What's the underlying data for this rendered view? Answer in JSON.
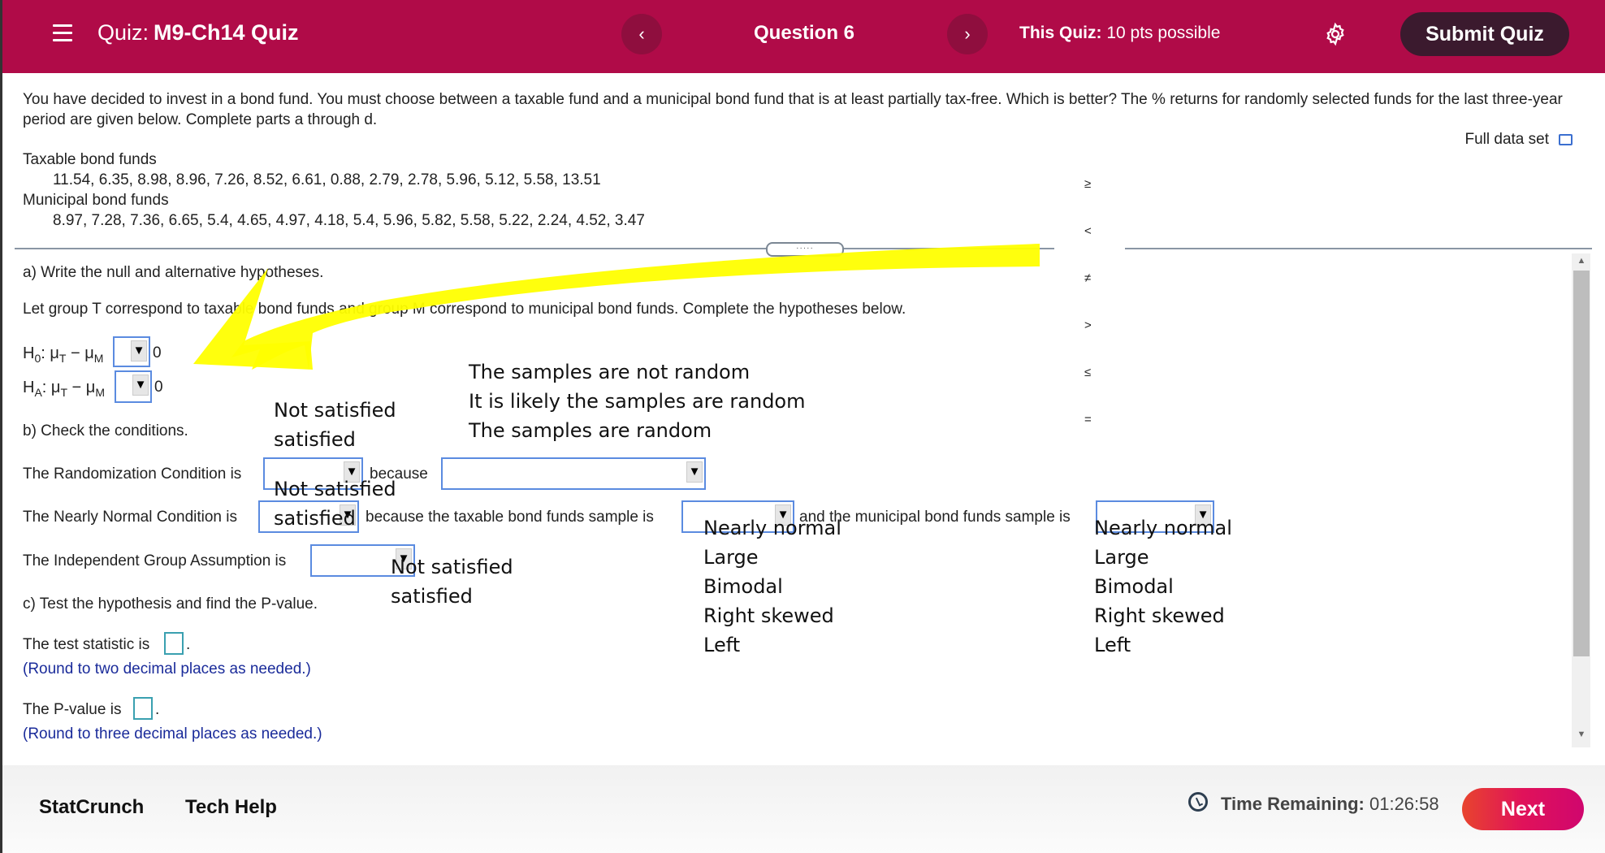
{
  "header": {
    "quiz_prefix": "Quiz:",
    "quiz_name": "M9-Ch14 Quiz",
    "prev_label": "‹",
    "next_label": "›",
    "question_label": "Question 6",
    "points_label": "This Quiz:",
    "points_value": "10 pts possible",
    "submit_label": "Submit Quiz",
    "bg_color": "#b00b48"
  },
  "question": {
    "intro": "You have decided to invest in a bond fund. You must choose between a taxable fund and a municipal bond fund that is at least partially tax-free. Which is better? The % returns for randomly selected funds for the last three-year period are given below. Complete parts a through d.",
    "full_data_label": "Full data set",
    "taxable_label": "Taxable bond funds",
    "taxable_values": "11.54, 6.35, 8.98, 8.96, 7.26, 8.52, 6.61, 0.88, 2.79, 2.78, 5.96, 5.12, 5.58, 13.51",
    "municipal_label": "Municipal bond funds",
    "municipal_values": "8.97, 7.28, 7.36, 6.65, 5.4, 4.65, 4.97, 4.18, 5.4, 5.96, 5.82, 5.58, 5.22, 2.24, 4.52, 3.47",
    "splitter_label": "·····"
  },
  "part_a": {
    "heading": "a) Write the null and alternative hypotheses.",
    "instruction": "Let group T correspond to taxable bond funds and group M correspond to municipal bond funds. Complete the hypotheses below.",
    "h0_label": "H",
    "h0_sub": "0",
    "ha_label": "H",
    "ha_sub": "A",
    "mu_t": ": μ",
    "sub_t": "T",
    "minus_mu": " − μ",
    "sub_m": "M",
    "h0_value": "",
    "ha_value": "",
    "rhs": "0",
    "operator_options": [
      "≥",
      "<",
      "≠",
      ">",
      "≤",
      "="
    ]
  },
  "part_b": {
    "heading": "b) Check the conditions.",
    "randomization_label": "The Randomization Condition is",
    "randomization_value": "",
    "because": "because",
    "because_value": "",
    "nearly_normal_label": "The Nearly Normal Condition is",
    "nearly_normal_value": "",
    "taxable_sample_label": "because the taxable bond funds sample is",
    "taxable_sample_value": "",
    "municipal_sample_label": "and the municipal bond funds sample is",
    "municipal_sample_value": "",
    "independent_label": "The Independent Group Assumption is",
    "independent_value": "",
    "condition_options": [
      "Not satisfied",
      "satisfied"
    ],
    "reason_options": [
      "The samples are not random",
      "It is likely the samples are random",
      "The samples are random"
    ],
    "shape_options": [
      "Nearly normal",
      "Large",
      "Bimodal",
      "Right skewed",
      "Left"
    ]
  },
  "part_c": {
    "heading": "c) Test the hypothesis and find the P-value.",
    "test_stat_label": "The test statistic is",
    "test_stat_value": "",
    "test_stat_hint": "(Round to two decimal places as needed.)",
    "pvalue_label": "The P-value is",
    "pvalue_value": "",
    "pvalue_hint": "(Round to three decimal places as needed.)",
    "period": "."
  },
  "footer": {
    "statcrunch_label": "StatCrunch",
    "techhelp_label": "Tech Help",
    "time_label": "Time Remaining:",
    "time_value": "01:26:58",
    "next_label": "Next"
  },
  "annotation": {
    "arrow_color": "#ffff00"
  }
}
